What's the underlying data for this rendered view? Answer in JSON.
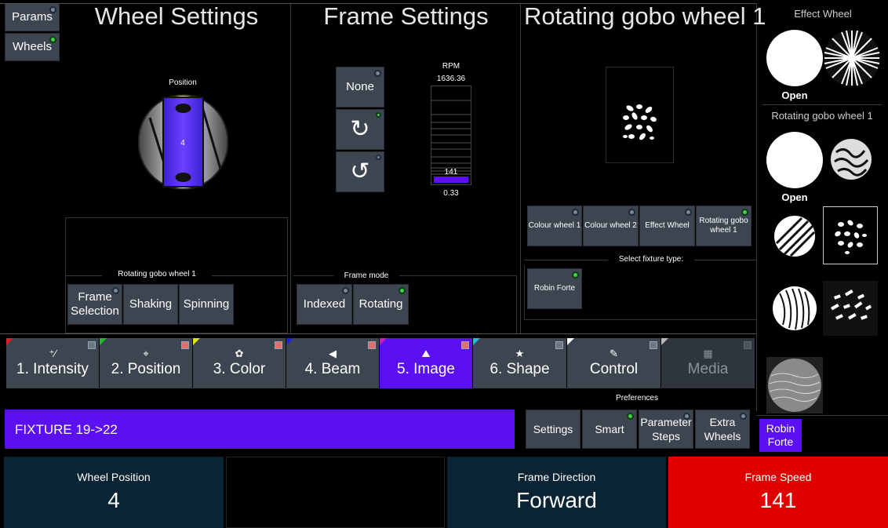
{
  "side_nav": {
    "params": "Params",
    "wheels": "Wheels"
  },
  "wheel_settings": {
    "title": "Wheel Settings",
    "position_label": "Position",
    "position_value": "4",
    "group_label": "Rotating gobo wheel 1",
    "buttons": [
      "Frame Selection",
      "Shaking",
      "Spinning"
    ]
  },
  "frame_settings": {
    "title": "Frame Settings",
    "none_label": "None",
    "rotate_cw_icon": "rotate-clockwise-icon",
    "rotate_ccw_icon": "rotate-counterclockwise-icon",
    "rpm_label": "RPM",
    "rpm_max": "1636.36",
    "rpm_value": "141",
    "rpm_min": "0.33",
    "mode_label": "Frame mode",
    "mode_buttons": [
      "Indexed",
      "Rotating"
    ]
  },
  "rotating_gobo": {
    "title": "Rotating gobo wheel 1",
    "wheel_buttons": [
      "Colour wheel 1",
      "Colour wheel 2",
      "Effect Wheel",
      "Rotating gobo wheel 1"
    ],
    "select_label": "Select fixture type:",
    "fixture_button": "Robin Forte"
  },
  "gobo_palette": {
    "effect_wheel_label": "Effect Wheel",
    "effect_open_label": "Open",
    "rotating_label": "Rotating gobo wheel 1",
    "rotating_open_label": "Open",
    "fixture_label": "Robin Forte"
  },
  "tabs": [
    {
      "label": "1. Intensity",
      "icon": "intensity-icon",
      "glyph": "⁺∕",
      "corner": "#e02020"
    },
    {
      "label": "2. Position",
      "icon": "position-icon",
      "glyph": "⌖",
      "corner": "#20c020"
    },
    {
      "label": "3. Color",
      "icon": "palette-icon",
      "glyph": "🎨",
      "corner": "#e0e020"
    },
    {
      "label": "4. Beam",
      "icon": "beam-icon",
      "glyph": "◀",
      "corner": "#2020e0"
    },
    {
      "label": "5. Image",
      "icon": "image-icon",
      "glyph": "⛰",
      "corner": "#c020c0"
    },
    {
      "label": "6. Shape",
      "icon": "star-icon",
      "glyph": "★",
      "corner": "#20c0e0"
    },
    {
      "label": "Control",
      "icon": "control-icon",
      "glyph": "✎",
      "corner": "#ffffff"
    },
    {
      "label": "Media",
      "icon": "media-icon",
      "glyph": "▦",
      "corner": "#bbbbbb"
    }
  ],
  "command_line": "FIXTURE 19->22",
  "preferences": {
    "label": "Preferences",
    "buttons": [
      "Settings",
      "Smart",
      "Parameter Steps",
      "Extra Wheels"
    ]
  },
  "status": {
    "wheel_position_label": "Wheel Position",
    "wheel_position_value": "4",
    "frame_direction_label": "Frame Direction",
    "frame_direction_value": "Forward",
    "frame_speed_label": "Frame Speed",
    "frame_speed_value": "141"
  },
  "colors": {
    "accent": "#5a10f0",
    "button": "#3d4650",
    "status_box": "#0a2433",
    "speed_box": "#e00000"
  }
}
